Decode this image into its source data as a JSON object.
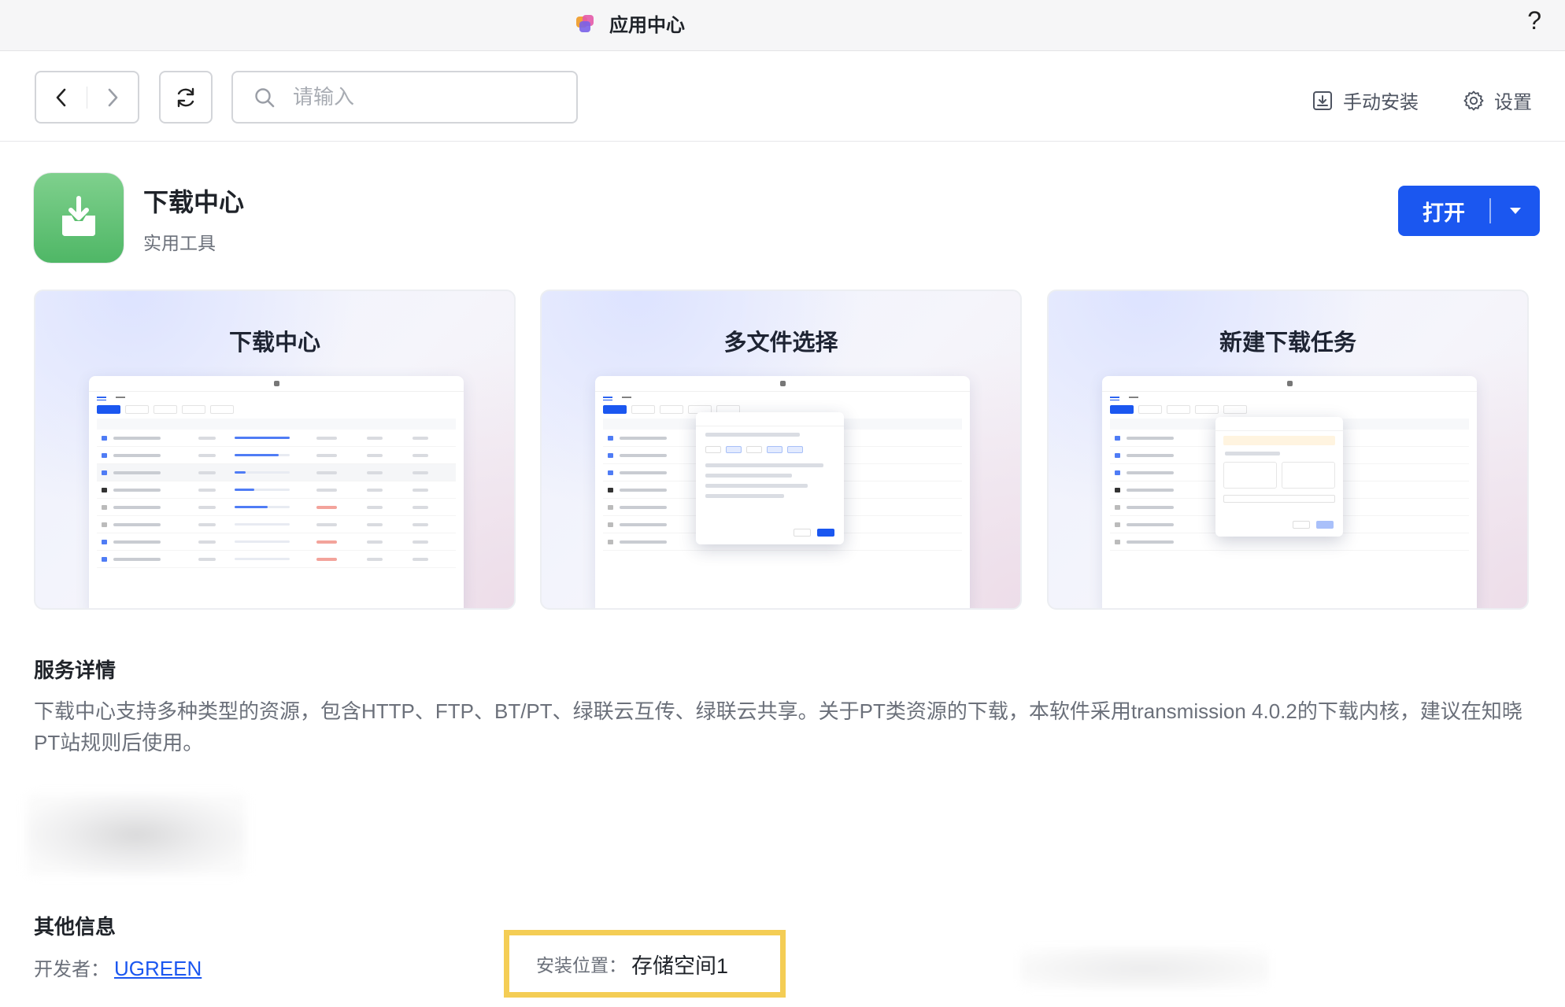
{
  "window": {
    "title": "应用中心",
    "help": "?"
  },
  "toolbar": {
    "search_placeholder": "请输入",
    "manual_install": "手动安装",
    "settings": "设置"
  },
  "app": {
    "name": "下载中心",
    "category": "实用工具",
    "open_label": "打开"
  },
  "screenshots": [
    {
      "title": "下载中心"
    },
    {
      "title": "多文件选择"
    },
    {
      "title": "新建下载任务"
    }
  ],
  "service": {
    "title": "服务详情",
    "description": "下载中心支持多种类型的资源，包含HTTP、FTP、BT/PT、绿联云互传、绿联云共享。关于PT类资源的下载，本软件采用transmission 4.0.2的下载内核，建议在知晓PT站规则后使用。"
  },
  "other": {
    "title": "其他信息",
    "developer_label": "开发者：",
    "developer": "UGREEN",
    "install_label": "安装位置：",
    "install_value": "存储空间1"
  },
  "colors": {
    "primary": "#1b57f0",
    "highlight": "#f4cd55",
    "app_icon": "#5cbf6f"
  }
}
